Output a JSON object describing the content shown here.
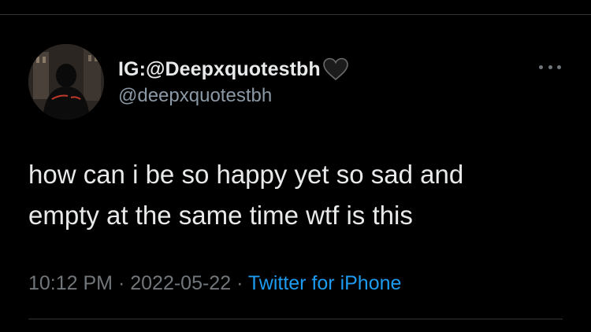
{
  "tweet": {
    "display_name": "IG:@Deepxquotestbh",
    "handle": "@deepxquotestbh",
    "text_lines": [
      "how can i be so happy yet so sad and",
      "empty at the same time wtf is this"
    ],
    "time": "10:12 PM",
    "separator": " · ",
    "date": "2022-05-22",
    "source": "Twitter for iPhone"
  },
  "icons": {
    "avatar": "avatar-image",
    "name_emoji": "black-heart-icon",
    "more": "more-options-icon"
  },
  "colors": {
    "background": "#000000",
    "primary_text": "#e7e9ea",
    "secondary_text": "#71767b",
    "link": "#1d9bf0",
    "divider": "#2f3336"
  }
}
